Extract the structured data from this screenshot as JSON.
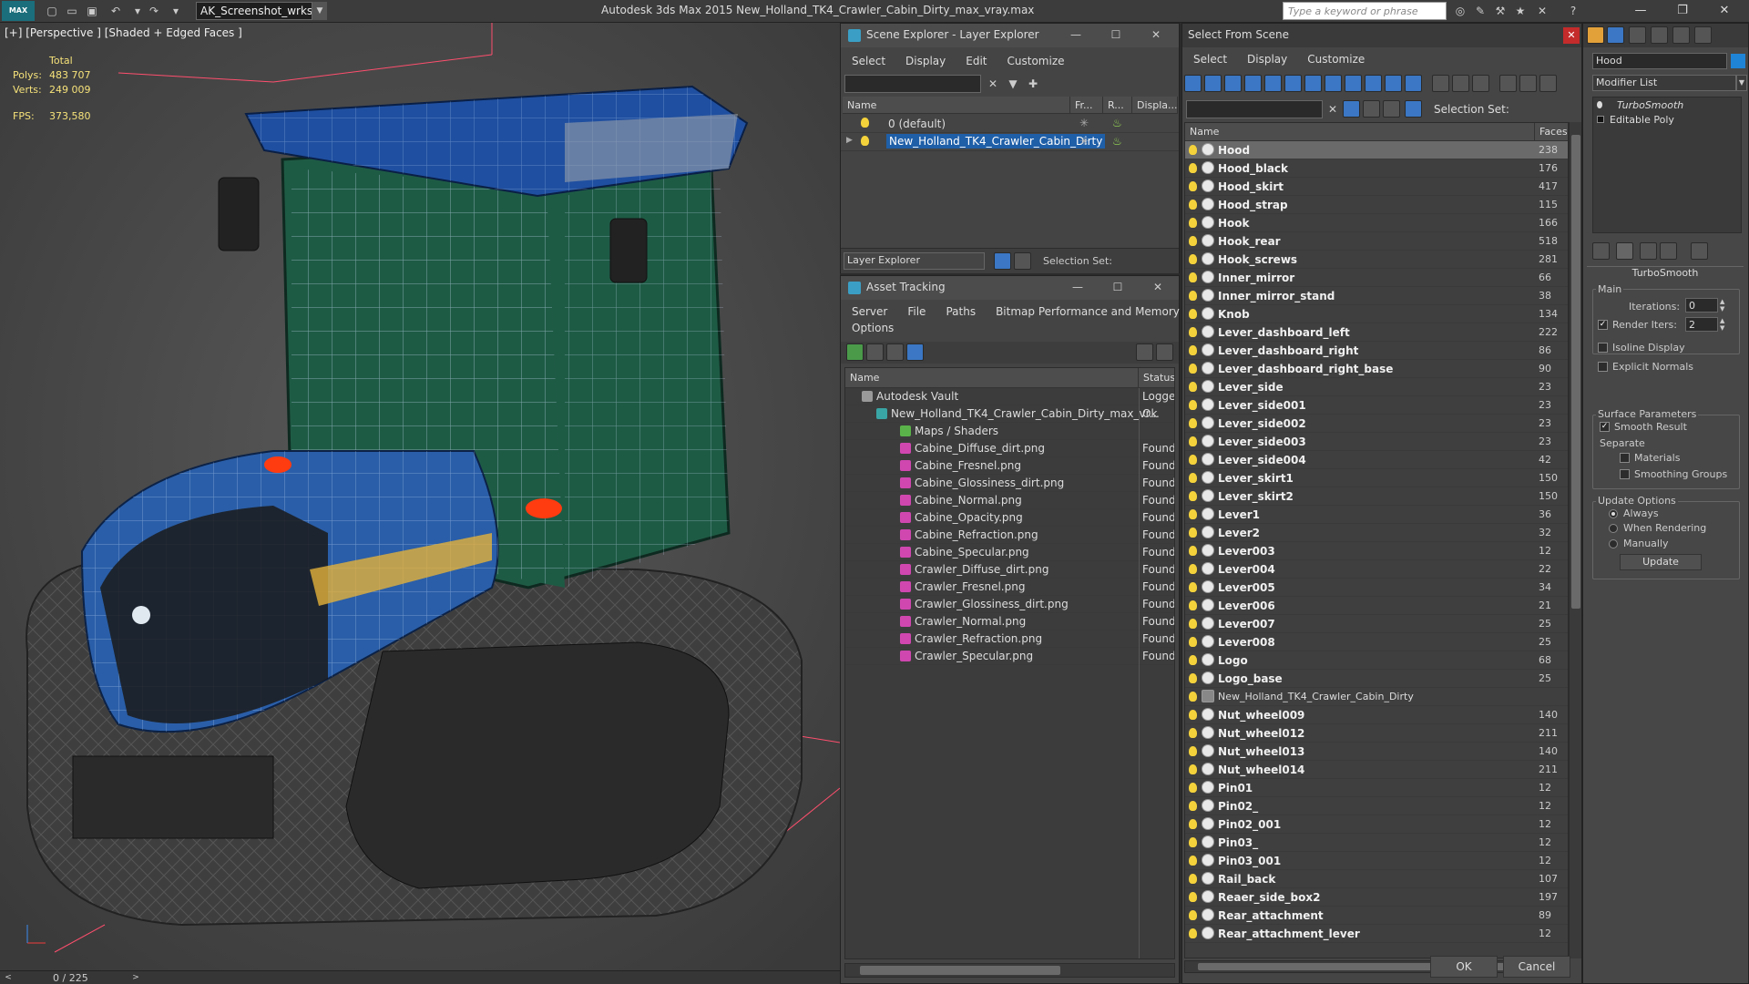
{
  "app": {
    "workspace": "AK_Screenshot_wrksp",
    "title": "Autodesk 3ds Max  2015    New_Holland_TK4_Crawler_Cabin_Dirty_max_vray.max",
    "search_placeholder": "Type a keyword or phrase",
    "logo_text": "MAX"
  },
  "viewport": {
    "label": "[+] [Perspective ] [Shaded + Edged Faces ]",
    "stats_header": "Total",
    "polys_label": "Polys:",
    "polys_value": "483 707",
    "verts_label": "Verts:",
    "verts_value": "249 009",
    "fps_label": "FPS:",
    "fps_value": "373,580"
  },
  "timeline": {
    "frame": "0 / 225"
  },
  "scene_explorer": {
    "title": "Scene Explorer - Layer Explorer",
    "menu": [
      "Select",
      "Display",
      "Edit",
      "Customize"
    ],
    "columns": [
      "Name",
      "Fr...",
      "R...",
      "Displa..."
    ],
    "layers": [
      "0 (default)",
      "New_Holland_TK4_Crawler_Cabin_Dirty"
    ],
    "footer_dropdown": "Layer Explorer",
    "selection_set_label": "Selection Set:"
  },
  "asset_tracking": {
    "title": "Asset Tracking",
    "menu": [
      "Server",
      "File",
      "Paths",
      "Bitmap Performance and Memory"
    ],
    "menu2": "Options",
    "columns": [
      "Name",
      "Status"
    ],
    "rows": [
      {
        "name": "Autodesk Vault",
        "status": "Logged"
      },
      {
        "name": "New_Holland_TK4_Crawler_Cabin_Dirty_max_vr...",
        "status": "Ok"
      },
      {
        "name": "Maps / Shaders",
        "status": ""
      },
      {
        "name": "Cabine_Diffuse_dirt.png",
        "status": "Found"
      },
      {
        "name": "Cabine_Fresnel.png",
        "status": "Found"
      },
      {
        "name": "Cabine_Glossiness_dirt.png",
        "status": "Found"
      },
      {
        "name": "Cabine_Normal.png",
        "status": "Found"
      },
      {
        "name": "Cabine_Opacity.png",
        "status": "Found"
      },
      {
        "name": "Cabine_Refraction.png",
        "status": "Found"
      },
      {
        "name": "Cabine_Specular.png",
        "status": "Found"
      },
      {
        "name": "Crawler_Diffuse_dirt.png",
        "status": "Found"
      },
      {
        "name": "Crawler_Fresnel.png",
        "status": "Found"
      },
      {
        "name": "Crawler_Glossiness_dirt.png",
        "status": "Found"
      },
      {
        "name": "Crawler_Normal.png",
        "status": "Found"
      },
      {
        "name": "Crawler_Refraction.png",
        "status": "Found"
      },
      {
        "name": "Crawler_Specular.png",
        "status": "Found"
      }
    ]
  },
  "select_from_scene": {
    "title": "Select From Scene",
    "menu": [
      "Select",
      "Display",
      "Customize"
    ],
    "selection_set_label": "Selection Set:",
    "columns": [
      "Name",
      "Faces"
    ],
    "objects": [
      {
        "name": "Hood",
        "faces": "238"
      },
      {
        "name": "Hood_black",
        "faces": "176"
      },
      {
        "name": "Hood_skirt",
        "faces": "417"
      },
      {
        "name": "Hood_strap",
        "faces": "115"
      },
      {
        "name": "Hook",
        "faces": "166"
      },
      {
        "name": "Hook_rear",
        "faces": "518"
      },
      {
        "name": "Hook_screws",
        "faces": "281"
      },
      {
        "name": "Inner_mirror",
        "faces": "66"
      },
      {
        "name": "Inner_mirror_stand",
        "faces": "38"
      },
      {
        "name": "Knob",
        "faces": "134"
      },
      {
        "name": "Lever_dashboard_left",
        "faces": "222"
      },
      {
        "name": "Lever_dashboard_right",
        "faces": "86"
      },
      {
        "name": "Lever_dashboard_right_base",
        "faces": "90"
      },
      {
        "name": "Lever_side",
        "faces": "23"
      },
      {
        "name": "Lever_side001",
        "faces": "23"
      },
      {
        "name": "Lever_side002",
        "faces": "23"
      },
      {
        "name": "Lever_side003",
        "faces": "23"
      },
      {
        "name": "Lever_side004",
        "faces": "42"
      },
      {
        "name": "Lever_skirt1",
        "faces": "150"
      },
      {
        "name": "Lever_skirt2",
        "faces": "150"
      },
      {
        "name": "Lever1",
        "faces": "36"
      },
      {
        "name": "Lever2",
        "faces": "32"
      },
      {
        "name": "Lever003",
        "faces": "12"
      },
      {
        "name": "Lever004",
        "faces": "22"
      },
      {
        "name": "Lever005",
        "faces": "34"
      },
      {
        "name": "Lever006",
        "faces": "21"
      },
      {
        "name": "Lever007",
        "faces": "25"
      },
      {
        "name": "Lever008",
        "faces": "25"
      },
      {
        "name": "Logo",
        "faces": "68"
      },
      {
        "name": "Logo_base",
        "faces": "25"
      },
      {
        "name": "New_Holland_TK4_Crawler_Cabin_Dirty",
        "faces": ""
      },
      {
        "name": "Nut_wheel009",
        "faces": "140"
      },
      {
        "name": "Nut_wheel012",
        "faces": "211"
      },
      {
        "name": "Nut_wheel013",
        "faces": "140"
      },
      {
        "name": "Nut_wheel014",
        "faces": "211"
      },
      {
        "name": "Pin01",
        "faces": "12"
      },
      {
        "name": "Pin02_",
        "faces": "12"
      },
      {
        "name": "Pin02_001",
        "faces": "12"
      },
      {
        "name": "Pin03_",
        "faces": "12"
      },
      {
        "name": "Pin03_001",
        "faces": "12"
      },
      {
        "name": "Rail_back",
        "faces": "107"
      },
      {
        "name": "Reaer_side_box2",
        "faces": "197"
      },
      {
        "name": "Rear_attachment",
        "faces": "89"
      },
      {
        "name": "Rear_attachment_lever",
        "faces": "12"
      }
    ],
    "ok_label": "OK",
    "cancel_label": "Cancel"
  },
  "command_panel": {
    "object_name": "Hood",
    "modifier_list": "Modifier List",
    "stack": [
      "TurboSmooth",
      "Editable Poly"
    ],
    "rollout_title": "TurboSmooth",
    "main_label": "Main",
    "iterations_label": "Iterations:",
    "iterations_value": "0",
    "render_iters_label": "Render Iters:",
    "render_iters_value": "2",
    "isoline_label": "Isoline Display",
    "explicit_normals_label": "Explicit Normals",
    "surface_params_label": "Surface Parameters",
    "smooth_result_label": "Smooth Result",
    "separate_label": "Separate",
    "materials_label": "Materials",
    "smoothing_groups_label": "Smoothing Groups",
    "update_options_label": "Update Options",
    "always_label": "Always",
    "when_rendering_label": "When Rendering",
    "manually_label": "Manually",
    "update_button": "Update"
  },
  "colors": {
    "accent": "#1f5fa8",
    "cabin_green": "#1e5b45",
    "hood_blue": "#2a5ea8"
  }
}
